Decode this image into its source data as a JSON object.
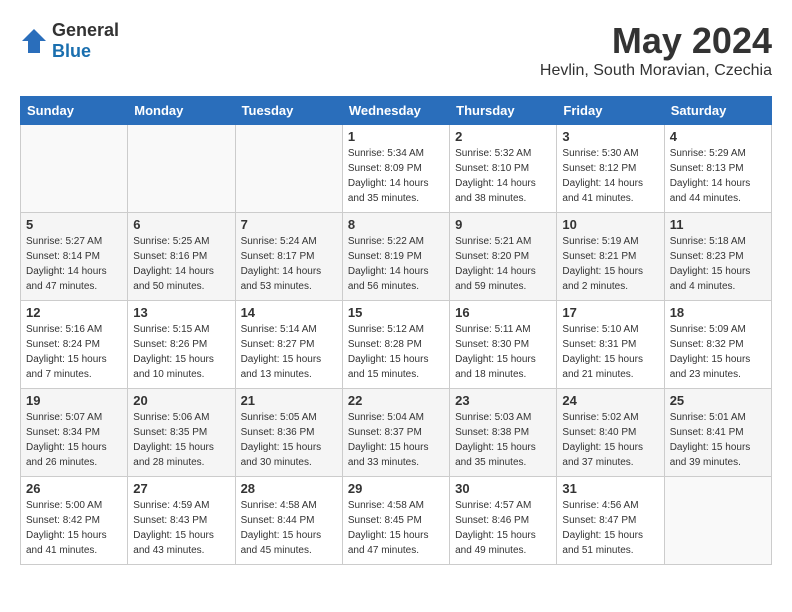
{
  "header": {
    "logo_general": "General",
    "logo_blue": "Blue",
    "month_year": "May 2024",
    "location": "Hevlin, South Moravian, Czechia"
  },
  "weekdays": [
    "Sunday",
    "Monday",
    "Tuesday",
    "Wednesday",
    "Thursday",
    "Friday",
    "Saturday"
  ],
  "weeks": [
    [
      {
        "day": "",
        "sunrise": "",
        "sunset": "",
        "daylight": ""
      },
      {
        "day": "",
        "sunrise": "",
        "sunset": "",
        "daylight": ""
      },
      {
        "day": "",
        "sunrise": "",
        "sunset": "",
        "daylight": ""
      },
      {
        "day": "1",
        "sunrise": "Sunrise: 5:34 AM",
        "sunset": "Sunset: 8:09 PM",
        "daylight": "Daylight: 14 hours and 35 minutes."
      },
      {
        "day": "2",
        "sunrise": "Sunrise: 5:32 AM",
        "sunset": "Sunset: 8:10 PM",
        "daylight": "Daylight: 14 hours and 38 minutes."
      },
      {
        "day": "3",
        "sunrise": "Sunrise: 5:30 AM",
        "sunset": "Sunset: 8:12 PM",
        "daylight": "Daylight: 14 hours and 41 minutes."
      },
      {
        "day": "4",
        "sunrise": "Sunrise: 5:29 AM",
        "sunset": "Sunset: 8:13 PM",
        "daylight": "Daylight: 14 hours and 44 minutes."
      }
    ],
    [
      {
        "day": "5",
        "sunrise": "Sunrise: 5:27 AM",
        "sunset": "Sunset: 8:14 PM",
        "daylight": "Daylight: 14 hours and 47 minutes."
      },
      {
        "day": "6",
        "sunrise": "Sunrise: 5:25 AM",
        "sunset": "Sunset: 8:16 PM",
        "daylight": "Daylight: 14 hours and 50 minutes."
      },
      {
        "day": "7",
        "sunrise": "Sunrise: 5:24 AM",
        "sunset": "Sunset: 8:17 PM",
        "daylight": "Daylight: 14 hours and 53 minutes."
      },
      {
        "day": "8",
        "sunrise": "Sunrise: 5:22 AM",
        "sunset": "Sunset: 8:19 PM",
        "daylight": "Daylight: 14 hours and 56 minutes."
      },
      {
        "day": "9",
        "sunrise": "Sunrise: 5:21 AM",
        "sunset": "Sunset: 8:20 PM",
        "daylight": "Daylight: 14 hours and 59 minutes."
      },
      {
        "day": "10",
        "sunrise": "Sunrise: 5:19 AM",
        "sunset": "Sunset: 8:21 PM",
        "daylight": "Daylight: 15 hours and 2 minutes."
      },
      {
        "day": "11",
        "sunrise": "Sunrise: 5:18 AM",
        "sunset": "Sunset: 8:23 PM",
        "daylight": "Daylight: 15 hours and 4 minutes."
      }
    ],
    [
      {
        "day": "12",
        "sunrise": "Sunrise: 5:16 AM",
        "sunset": "Sunset: 8:24 PM",
        "daylight": "Daylight: 15 hours and 7 minutes."
      },
      {
        "day": "13",
        "sunrise": "Sunrise: 5:15 AM",
        "sunset": "Sunset: 8:26 PM",
        "daylight": "Daylight: 15 hours and 10 minutes."
      },
      {
        "day": "14",
        "sunrise": "Sunrise: 5:14 AM",
        "sunset": "Sunset: 8:27 PM",
        "daylight": "Daylight: 15 hours and 13 minutes."
      },
      {
        "day": "15",
        "sunrise": "Sunrise: 5:12 AM",
        "sunset": "Sunset: 8:28 PM",
        "daylight": "Daylight: 15 hours and 15 minutes."
      },
      {
        "day": "16",
        "sunrise": "Sunrise: 5:11 AM",
        "sunset": "Sunset: 8:30 PM",
        "daylight": "Daylight: 15 hours and 18 minutes."
      },
      {
        "day": "17",
        "sunrise": "Sunrise: 5:10 AM",
        "sunset": "Sunset: 8:31 PM",
        "daylight": "Daylight: 15 hours and 21 minutes."
      },
      {
        "day": "18",
        "sunrise": "Sunrise: 5:09 AM",
        "sunset": "Sunset: 8:32 PM",
        "daylight": "Daylight: 15 hours and 23 minutes."
      }
    ],
    [
      {
        "day": "19",
        "sunrise": "Sunrise: 5:07 AM",
        "sunset": "Sunset: 8:34 PM",
        "daylight": "Daylight: 15 hours and 26 minutes."
      },
      {
        "day": "20",
        "sunrise": "Sunrise: 5:06 AM",
        "sunset": "Sunset: 8:35 PM",
        "daylight": "Daylight: 15 hours and 28 minutes."
      },
      {
        "day": "21",
        "sunrise": "Sunrise: 5:05 AM",
        "sunset": "Sunset: 8:36 PM",
        "daylight": "Daylight: 15 hours and 30 minutes."
      },
      {
        "day": "22",
        "sunrise": "Sunrise: 5:04 AM",
        "sunset": "Sunset: 8:37 PM",
        "daylight": "Daylight: 15 hours and 33 minutes."
      },
      {
        "day": "23",
        "sunrise": "Sunrise: 5:03 AM",
        "sunset": "Sunset: 8:38 PM",
        "daylight": "Daylight: 15 hours and 35 minutes."
      },
      {
        "day": "24",
        "sunrise": "Sunrise: 5:02 AM",
        "sunset": "Sunset: 8:40 PM",
        "daylight": "Daylight: 15 hours and 37 minutes."
      },
      {
        "day": "25",
        "sunrise": "Sunrise: 5:01 AM",
        "sunset": "Sunset: 8:41 PM",
        "daylight": "Daylight: 15 hours and 39 minutes."
      }
    ],
    [
      {
        "day": "26",
        "sunrise": "Sunrise: 5:00 AM",
        "sunset": "Sunset: 8:42 PM",
        "daylight": "Daylight: 15 hours and 41 minutes."
      },
      {
        "day": "27",
        "sunrise": "Sunrise: 4:59 AM",
        "sunset": "Sunset: 8:43 PM",
        "daylight": "Daylight: 15 hours and 43 minutes."
      },
      {
        "day": "28",
        "sunrise": "Sunrise: 4:58 AM",
        "sunset": "Sunset: 8:44 PM",
        "daylight": "Daylight: 15 hours and 45 minutes."
      },
      {
        "day": "29",
        "sunrise": "Sunrise: 4:58 AM",
        "sunset": "Sunset: 8:45 PM",
        "daylight": "Daylight: 15 hours and 47 minutes."
      },
      {
        "day": "30",
        "sunrise": "Sunrise: 4:57 AM",
        "sunset": "Sunset: 8:46 PM",
        "daylight": "Daylight: 15 hours and 49 minutes."
      },
      {
        "day": "31",
        "sunrise": "Sunrise: 4:56 AM",
        "sunset": "Sunset: 8:47 PM",
        "daylight": "Daylight: 15 hours and 51 minutes."
      },
      {
        "day": "",
        "sunrise": "",
        "sunset": "",
        "daylight": ""
      }
    ]
  ]
}
